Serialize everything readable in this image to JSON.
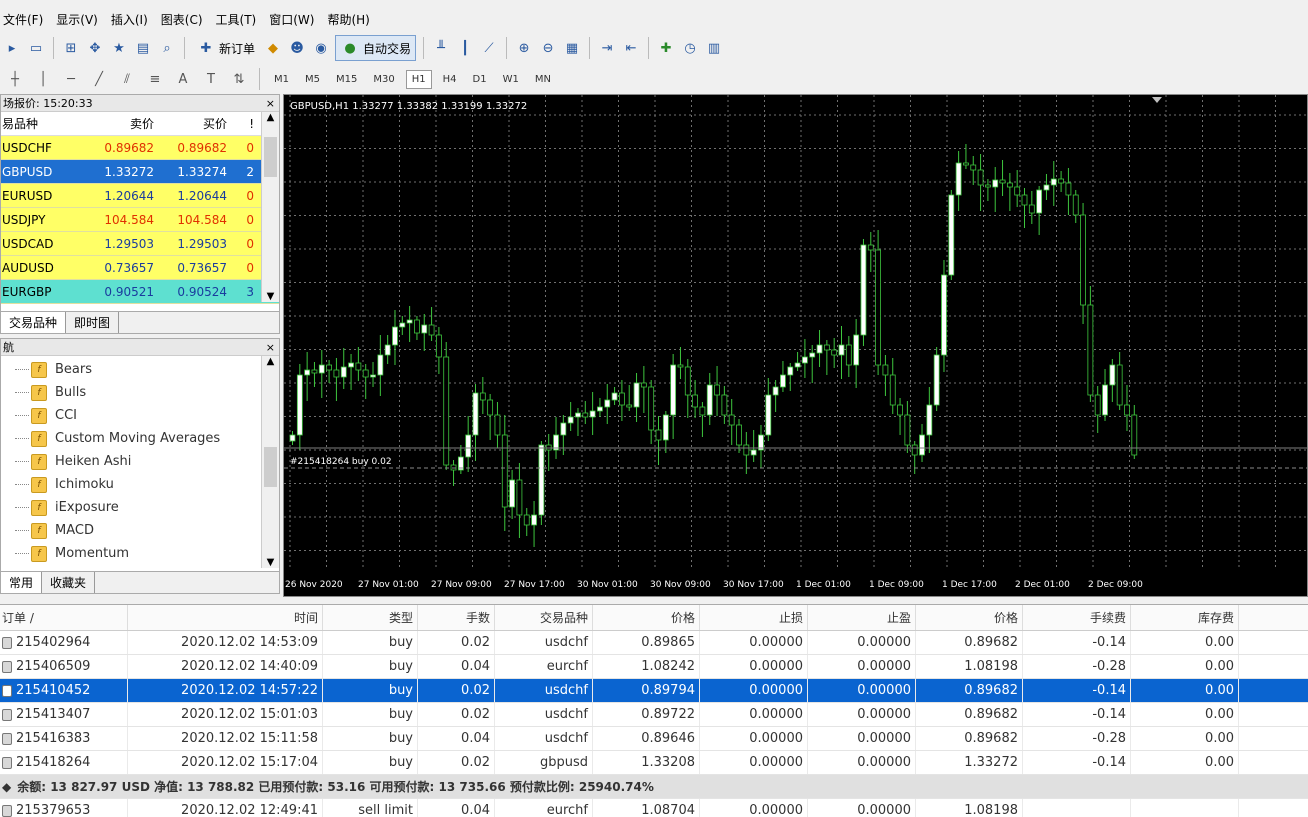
{
  "menu": [
    "文件(F)",
    "显示(V)",
    "插入(I)",
    "图表(C)",
    "工具(T)",
    "窗口(W)",
    "帮助(H)"
  ],
  "toolbar": {
    "new_order_label": "新订单",
    "autotrade_label": "自动交易"
  },
  "timeframes": [
    "M1",
    "M5",
    "M15",
    "M30",
    "H1",
    "H4",
    "D1",
    "W1",
    "MN"
  ],
  "active_timeframe": "H1",
  "market_watch": {
    "title": "场报价: 15:20:33",
    "headers": {
      "symbol": "易品种",
      "bid": "卖价",
      "ask": "买价",
      "spread": "!"
    },
    "rows": [
      {
        "symbol": "USDCHF",
        "bid": "0.89682",
        "ask": "0.89682",
        "spread": "0"
      },
      {
        "symbol": "GBPUSD",
        "bid": "1.33272",
        "ask": "1.33274",
        "spread": "2"
      },
      {
        "symbol": "EURUSD",
        "bid": "1.20644",
        "ask": "1.20644",
        "spread": "0"
      },
      {
        "symbol": "USDJPY",
        "bid": "104.584",
        "ask": "104.584",
        "spread": "0"
      },
      {
        "symbol": "USDCAD",
        "bid": "1.29503",
        "ask": "1.29503",
        "spread": "0"
      },
      {
        "symbol": "AUDUSD",
        "bid": "0.73657",
        "ask": "0.73657",
        "spread": "0"
      },
      {
        "symbol": "EURGBP",
        "bid": "0.90521",
        "ask": "0.90524",
        "spread": "3"
      }
    ],
    "tabs": [
      "交易品种",
      "即时图"
    ]
  },
  "navigator": {
    "title": "航",
    "items": [
      "Bears",
      "Bulls",
      "CCI",
      "Custom Moving Averages",
      "Heiken Ashi",
      "Ichimoku",
      "iExposure",
      "MACD",
      "Momentum"
    ],
    "tabs": [
      "常用",
      "收藏夹"
    ]
  },
  "chart": {
    "header": "GBPUSD,H1  1.33277 1.33382 1.33199 1.33272",
    "order_line_label": "#215418264 buy 0.02",
    "x_labels": [
      "26 Nov 2020",
      "27 Nov 01:00",
      "27 Nov 09:00",
      "27 Nov 17:00",
      "30 Nov 01:00",
      "30 Nov 09:00",
      "30 Nov 17:00",
      "1 Dec 01:00",
      "1 Dec 09:00",
      "1 Dec 17:00",
      "2 Dec 01:00",
      "2 Dec 09:00"
    ],
    "colors": {
      "bull": "#ffffff",
      "bear": "#000000",
      "wick": "#3ec63e",
      "grid": "#707070"
    }
  },
  "terminal": {
    "headers": {
      "order": "订单 /",
      "time": "时间",
      "type": "类型",
      "volume": "手数",
      "symbol": "交易品种",
      "price": "价格",
      "sl": "止损",
      "tp": "止盈",
      "current": "价格",
      "commission": "手续费",
      "swap": "库存费"
    },
    "orders": [
      {
        "order": "215402964",
        "time": "2020.12.02 14:53:09",
        "type": "buy",
        "volume": "0.02",
        "symbol": "usdchf",
        "price": "0.89865",
        "sl": "0.00000",
        "tp": "0.00000",
        "current": "0.89682",
        "commission": "-0.14",
        "swap": "0.00"
      },
      {
        "order": "215406509",
        "time": "2020.12.02 14:40:09",
        "type": "buy",
        "volume": "0.04",
        "symbol": "eurchf",
        "price": "1.08242",
        "sl": "0.00000",
        "tp": "0.00000",
        "current": "1.08198",
        "commission": "-0.28",
        "swap": "0.00"
      },
      {
        "order": "215410452",
        "time": "2020.12.02 14:57:22",
        "type": "buy",
        "volume": "0.02",
        "symbol": "usdchf",
        "price": "0.89794",
        "sl": "0.00000",
        "tp": "0.00000",
        "current": "0.89682",
        "commission": "-0.14",
        "swap": "0.00"
      },
      {
        "order": "215413407",
        "time": "2020.12.02 15:01:03",
        "type": "buy",
        "volume": "0.02",
        "symbol": "usdchf",
        "price": "0.89722",
        "sl": "0.00000",
        "tp": "0.00000",
        "current": "0.89682",
        "commission": "-0.14",
        "swap": "0.00"
      },
      {
        "order": "215416383",
        "time": "2020.12.02 15:11:58",
        "type": "buy",
        "volume": "0.04",
        "symbol": "usdchf",
        "price": "0.89646",
        "sl": "0.00000",
        "tp": "0.00000",
        "current": "0.89682",
        "commission": "-0.28",
        "swap": "0.00"
      },
      {
        "order": "215418264",
        "time": "2020.12.02 15:17:04",
        "type": "buy",
        "volume": "0.02",
        "symbol": "gbpusd",
        "price": "1.33208",
        "sl": "0.00000",
        "tp": "0.00000",
        "current": "1.33272",
        "commission": "-0.14",
        "swap": "0.00"
      }
    ],
    "balance_line": "余额: 13 827.97 USD  净值: 13 788.82  已用预付款: 53.16  可用预付款: 13 735.66  预付款比例: 25940.74%",
    "pending": {
      "order": "215379653",
      "time": "2020.12.02 12:49:41",
      "type": "sell limit",
      "volume": "0.04",
      "symbol": "eurchf",
      "price": "1.08704",
      "sl": "0.00000",
      "tp": "0.00000",
      "current": "1.08198"
    }
  }
}
